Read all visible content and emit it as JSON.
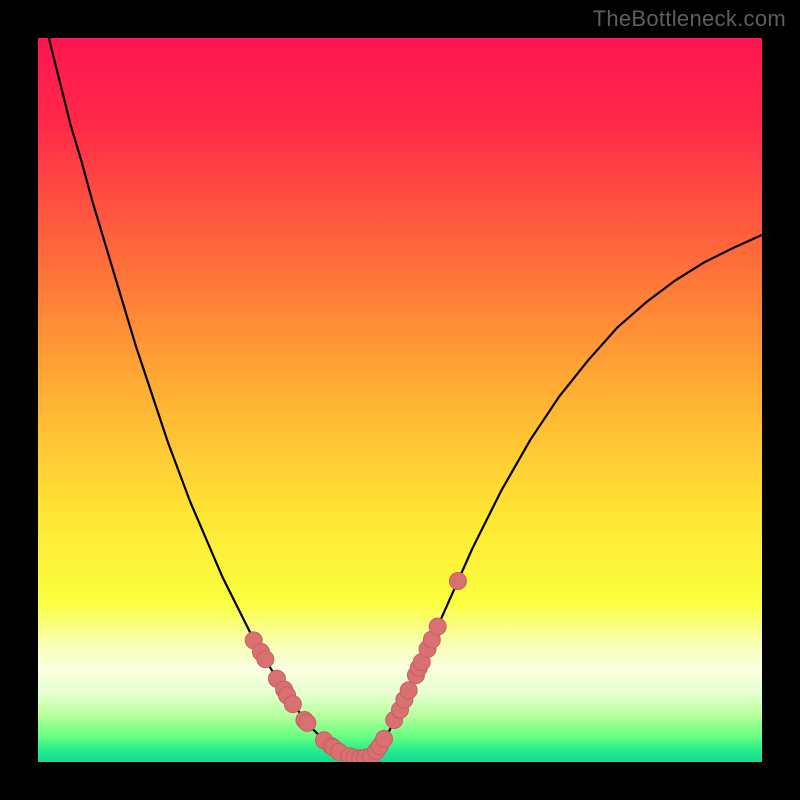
{
  "watermark": "TheBottleneck.com",
  "palette": {
    "frame": "#000000",
    "gradient_stops": [
      {
        "offset": 0.0,
        "color": "#ff1550"
      },
      {
        "offset": 0.12,
        "color": "#ff2a48"
      },
      {
        "offset": 0.3,
        "color": "#ff6a3a"
      },
      {
        "offset": 0.5,
        "color": "#ffb333"
      },
      {
        "offset": 0.66,
        "color": "#ffe634"
      },
      {
        "offset": 0.78,
        "color": "#fbff3f"
      },
      {
        "offset": 0.835,
        "color": "#f8ffb0"
      },
      {
        "offset": 0.87,
        "color": "#fbffe0"
      },
      {
        "offset": 0.905,
        "color": "#e6ffd0"
      },
      {
        "offset": 0.935,
        "color": "#b9ff9e"
      },
      {
        "offset": 0.965,
        "color": "#66ff80"
      },
      {
        "offset": 0.985,
        "color": "#20ec8e"
      },
      {
        "offset": 1.0,
        "color": "#19d895"
      }
    ],
    "curve": "#000000",
    "marker_fill": "#d97072",
    "marker_stroke": "#c85e61"
  },
  "chart_data": {
    "type": "line",
    "title": "",
    "xlabel": "",
    "ylabel": "",
    "xlim": [
      0,
      1
    ],
    "ylim": [
      0,
      1
    ],
    "series": [
      {
        "name": "bottleneck-curve",
        "x": [
          0.015,
          0.03,
          0.045,
          0.06,
          0.075,
          0.09,
          0.105,
          0.12,
          0.135,
          0.15,
          0.165,
          0.18,
          0.195,
          0.21,
          0.225,
          0.24,
          0.255,
          0.27,
          0.285,
          0.3,
          0.315,
          0.33,
          0.345,
          0.36,
          0.375,
          0.39,
          0.4,
          0.41,
          0.42,
          0.43,
          0.44,
          0.45,
          0.46,
          0.47,
          0.48,
          0.5,
          0.52,
          0.54,
          0.56,
          0.58,
          0.6,
          0.64,
          0.68,
          0.72,
          0.76,
          0.8,
          0.84,
          0.88,
          0.92,
          0.96,
          1.0
        ],
        "y": [
          1.0,
          0.94,
          0.88,
          0.83,
          0.775,
          0.725,
          0.675,
          0.625,
          0.575,
          0.53,
          0.485,
          0.44,
          0.4,
          0.36,
          0.325,
          0.29,
          0.255,
          0.225,
          0.195,
          0.165,
          0.14,
          0.115,
          0.09,
          0.07,
          0.05,
          0.035,
          0.025,
          0.018,
          0.012,
          0.008,
          0.005,
          0.005,
          0.008,
          0.018,
          0.033,
          0.072,
          0.115,
          0.16,
          0.205,
          0.25,
          0.295,
          0.375,
          0.445,
          0.505,
          0.555,
          0.6,
          0.635,
          0.665,
          0.69,
          0.71,
          0.728
        ]
      }
    ],
    "markers": {
      "name": "highlighted-points",
      "points": [
        {
          "x": 0.298,
          "y": 0.168
        },
        {
          "x": 0.308,
          "y": 0.152
        },
        {
          "x": 0.314,
          "y": 0.142
        },
        {
          "x": 0.33,
          "y": 0.115
        },
        {
          "x": 0.34,
          "y": 0.1
        },
        {
          "x": 0.344,
          "y": 0.092
        },
        {
          "x": 0.352,
          "y": 0.08
        },
        {
          "x": 0.368,
          "y": 0.058
        },
        {
          "x": 0.372,
          "y": 0.054
        },
        {
          "x": 0.395,
          "y": 0.03
        },
        {
          "x": 0.405,
          "y": 0.022
        },
        {
          "x": 0.408,
          "y": 0.02
        },
        {
          "x": 0.416,
          "y": 0.014
        },
        {
          "x": 0.43,
          "y": 0.008
        },
        {
          "x": 0.437,
          "y": 0.006
        },
        {
          "x": 0.445,
          "y": 0.005
        },
        {
          "x": 0.452,
          "y": 0.006
        },
        {
          "x": 0.46,
          "y": 0.008
        },
        {
          "x": 0.467,
          "y": 0.015
        },
        {
          "x": 0.472,
          "y": 0.022
        },
        {
          "x": 0.478,
          "y": 0.032
        },
        {
          "x": 0.492,
          "y": 0.058
        },
        {
          "x": 0.5,
          "y": 0.072
        },
        {
          "x": 0.506,
          "y": 0.086
        },
        {
          "x": 0.512,
          "y": 0.099
        },
        {
          "x": 0.522,
          "y": 0.12
        },
        {
          "x": 0.526,
          "y": 0.13
        },
        {
          "x": 0.53,
          "y": 0.138
        },
        {
          "x": 0.538,
          "y": 0.156
        },
        {
          "x": 0.544,
          "y": 0.169
        },
        {
          "x": 0.552,
          "y": 0.187
        },
        {
          "x": 0.58,
          "y": 0.25
        }
      ]
    }
  }
}
